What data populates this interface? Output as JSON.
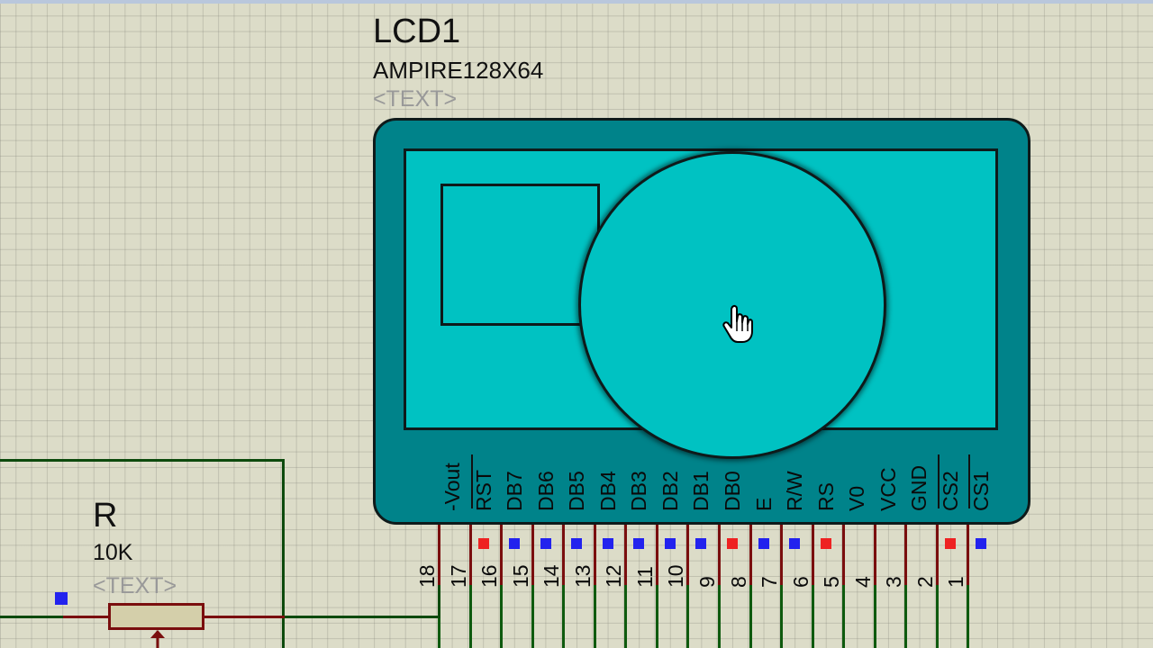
{
  "lcd": {
    "reference": "LCD1",
    "value": "AMPIRE128X64",
    "text_placeholder": "<TEXT>",
    "body_color": "#00838a",
    "screen_color": "#00c2c2",
    "pins": [
      {
        "name": "-Vout",
        "number": "18",
        "state": "none"
      },
      {
        "name": "RST",
        "number": "17",
        "state": "red"
      },
      {
        "name": "DB7",
        "number": "16",
        "state": "blue"
      },
      {
        "name": "DB6",
        "number": "15",
        "state": "blue"
      },
      {
        "name": "DB5",
        "number": "14",
        "state": "blue"
      },
      {
        "name": "DB4",
        "number": "13",
        "state": "blue"
      },
      {
        "name": "DB3",
        "number": "12",
        "state": "blue"
      },
      {
        "name": "DB2",
        "number": "11",
        "state": "blue"
      },
      {
        "name": "DB1",
        "number": "10",
        "state": "blue"
      },
      {
        "name": "DB0",
        "number": "9",
        "state": "red"
      },
      {
        "name": "E",
        "number": "8",
        "state": "blue"
      },
      {
        "name": "R/W",
        "number": "7",
        "state": "blue"
      },
      {
        "name": "RS",
        "number": "6",
        "state": "red"
      },
      {
        "name": "V0",
        "number": "5",
        "state": "none"
      },
      {
        "name": "VCC",
        "number": "4",
        "state": "none"
      },
      {
        "name": "GND",
        "number": "3",
        "state": "none"
      },
      {
        "name": "CS2",
        "number": "2",
        "state": "red"
      },
      {
        "name": "CS1",
        "number": "1",
        "state": "blue"
      }
    ]
  },
  "resistor": {
    "reference": "R",
    "value": "10K",
    "text_placeholder": "<TEXT>"
  },
  "colors": {
    "logic_high": "#ee2222",
    "logic_low": "#2222ee",
    "wire": "#0d4a0d",
    "pin_lead": "#7a0e0e"
  },
  "icons": {
    "cursor": "hand-pointer-icon"
  }
}
